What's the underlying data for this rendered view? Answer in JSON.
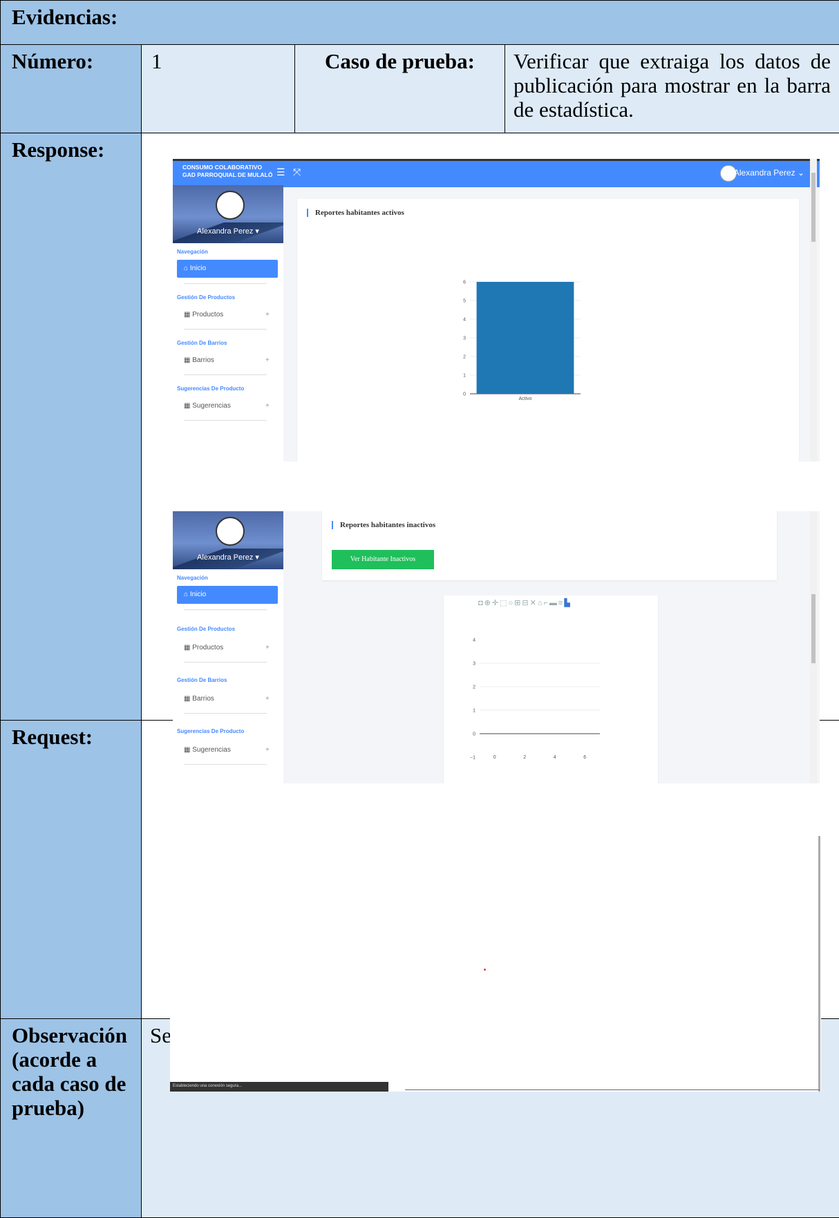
{
  "header": {
    "title": "Evidencias:"
  },
  "row_numero": {
    "label": "Número:",
    "value": "1",
    "case_label": "Caso de prueba:",
    "case_text": "Verificar que extraiga los datos de publicación para mostrar en la barra de estadística."
  },
  "row_response": {
    "label": "Response:"
  },
  "row_request": {
    "label": "Request:"
  },
  "row_observacion": {
    "label": "Observación (acorde a cada caso de prueba)",
    "text": "Se está validando que se extraiga los datos de los usuarios activos e inactivos."
  },
  "app": {
    "brand_line1": "CONSUMO COLABORATIVO",
    "brand_line2": "GAD PARROQUIAL DE MULALÓ",
    "user_name": "Alexandra Perez",
    "sidebar_user": "Alexandra Perez",
    "nav_section": "Navegación",
    "nav_home": "Inicio",
    "section_products": "Gestión De Productos",
    "item_products": "Productos",
    "section_barrios": "Gestión De Barrios",
    "item_barrios": "Barrios",
    "section_suggestions": "Sugerencias De Producto",
    "item_suggestions": "Sugerencias",
    "colors": {
      "primary": "#448aff",
      "success": "#1fbf5b",
      "bar": "#1f77b4"
    }
  },
  "screen1": {
    "card_title": "Reportes habitantes activos"
  },
  "screen2": {
    "card_title": "Reportes habitantes inactivos",
    "button_label": "Ver Habitante Inactivos"
  },
  "request_screen": {
    "status_text": "Estableciendo una conexión segura..."
  },
  "chart_data": [
    {
      "type": "bar",
      "categories": [
        "Activo"
      ],
      "values": [
        6
      ],
      "ylim": [
        0,
        6
      ],
      "yticks": [
        "0",
        "1",
        "2",
        "3",
        "4",
        "5",
        "6"
      ],
      "grid": true
    },
    {
      "type": "line",
      "x": [],
      "y": [],
      "xticks": [
        "0",
        "2",
        "4",
        "6"
      ],
      "yticks": [
        "−1",
        "0",
        "1",
        "2",
        "3",
        "4"
      ],
      "ylim": [
        -1,
        4
      ],
      "xlim": [
        -1,
        7
      ],
      "grid": true
    }
  ]
}
